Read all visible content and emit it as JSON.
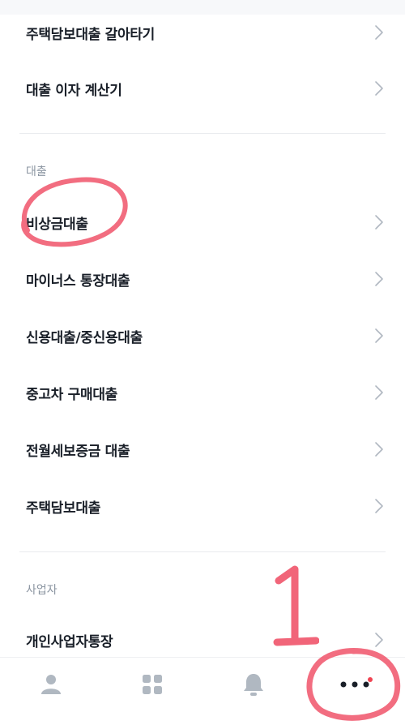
{
  "menu": {
    "loan_tools": [
      {
        "label": "주택담보대출 갈아타기"
      },
      {
        "label": "대출 이자 계산기"
      }
    ],
    "loan_section": {
      "title": "대출",
      "items": [
        {
          "label": "비상금대출"
        },
        {
          "label": "마이너스 통장대출"
        },
        {
          "label": "신용대출/중신용대출"
        },
        {
          "label": "중고차 구매대출"
        },
        {
          "label": "전월세보증금 대출"
        },
        {
          "label": "주택담보대출"
        }
      ]
    },
    "business_section": {
      "title": "사업자",
      "items": [
        {
          "label": "개인사업자통장"
        }
      ]
    }
  },
  "annotations": {
    "step_number": "1"
  },
  "tabbar": {
    "tabs": [
      {
        "icon": "person-icon"
      },
      {
        "icon": "grid-icon"
      },
      {
        "icon": "bell-icon"
      },
      {
        "icon": "more-icon",
        "badge_color": "#f04452"
      }
    ]
  },
  "colors": {
    "annotation_red": "#f0546a",
    "text_primary": "#191f28",
    "text_secondary": "#8b95a1",
    "icon_gray": "#b0b8c1"
  }
}
